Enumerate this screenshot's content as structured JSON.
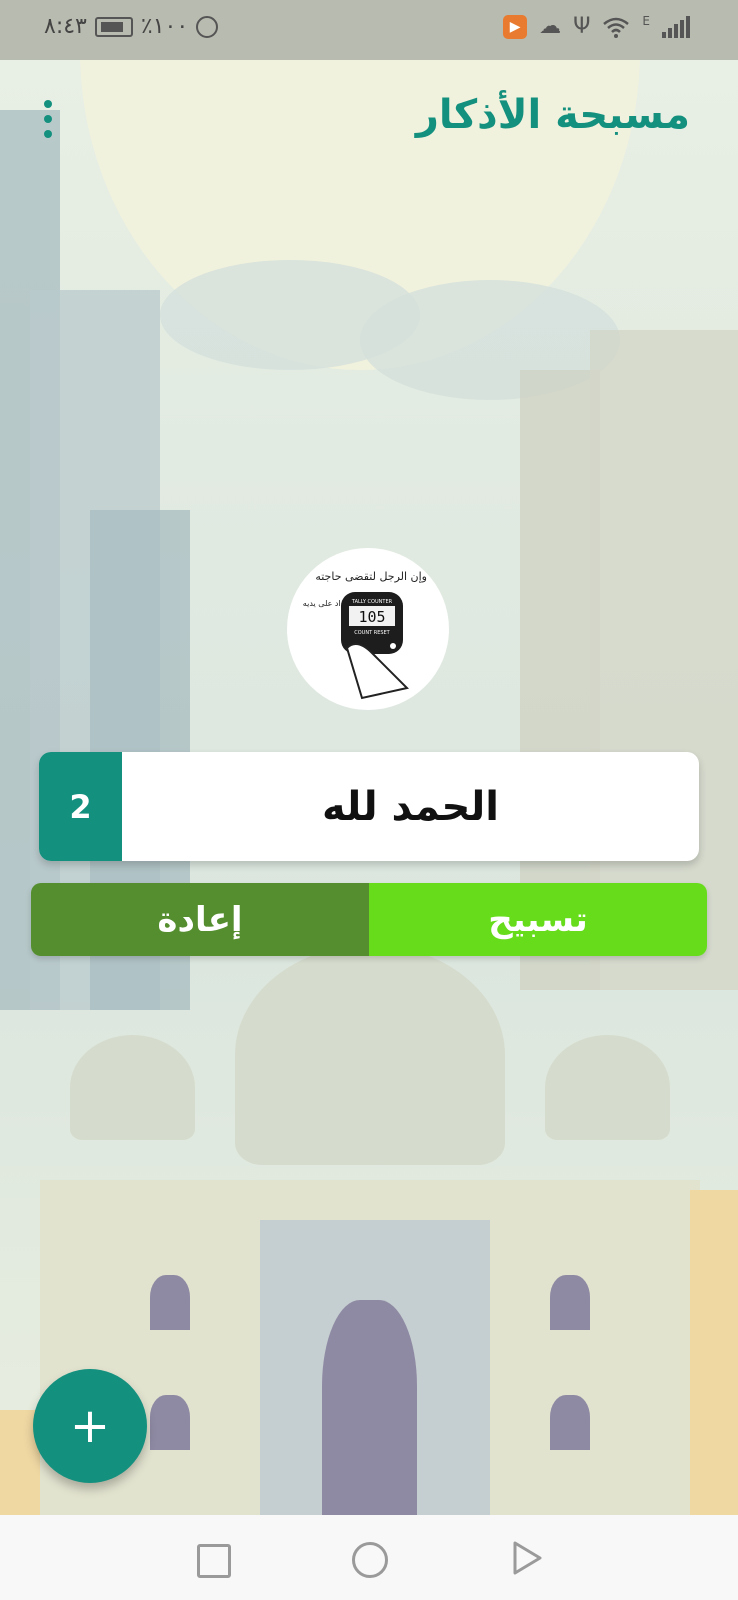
{
  "status_bar": {
    "time": "٨:٤٣",
    "battery": "٪١٠٠",
    "network_label": "E"
  },
  "header": {
    "title": "مسبحة الأذكار"
  },
  "counter_image": {
    "caption_line1": "وإن الرجل لتقضى حاجته",
    "caption_line2": "بكثرة تعداد على يديه",
    "display_value": "105",
    "device_label_top": "TALLY COUNTER",
    "device_label_bottom": "COUNT RESET"
  },
  "dhikr": {
    "count": "2",
    "text": "الحمد لله"
  },
  "buttons": {
    "reset_label": "إعادة",
    "tasbih_label": "تسبيح"
  },
  "fab": {
    "label": "+"
  },
  "colors": {
    "primary": "#14907f",
    "tasbih_button": "#67dc1b",
    "reset_button": "#548e2e"
  }
}
